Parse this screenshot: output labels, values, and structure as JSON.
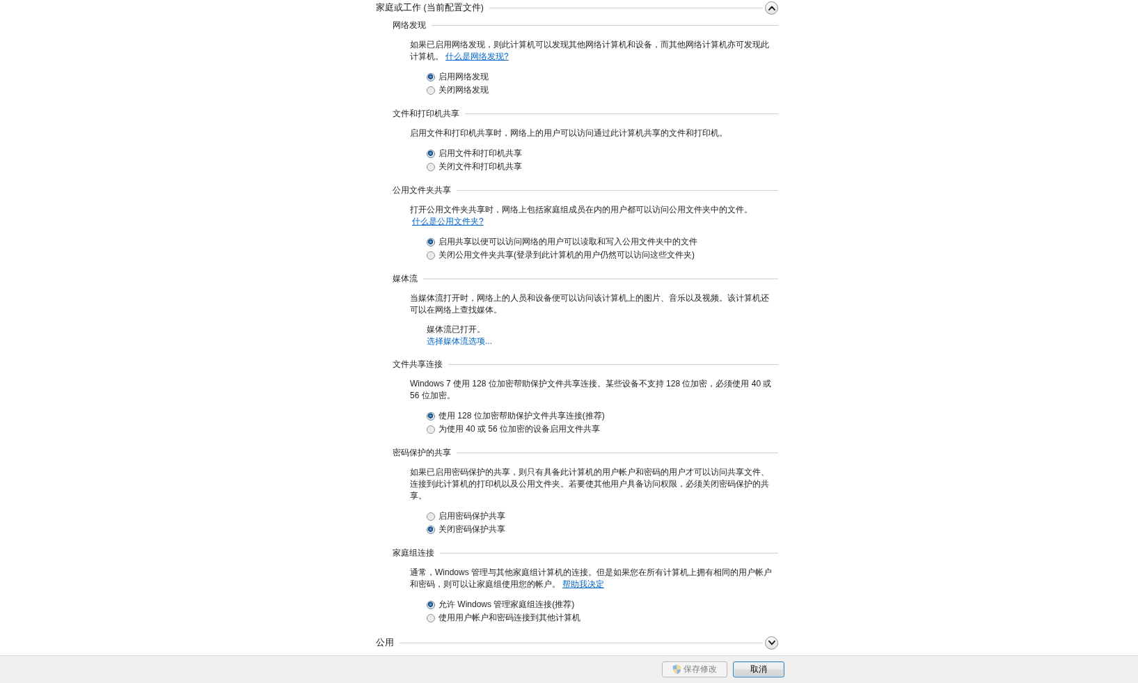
{
  "profiles": [
    {
      "title": "家庭或工作 (当前配置文件)",
      "expanded": true,
      "sections": [
        {
          "kind": "radio",
          "heading": "网络发现",
          "description": "如果已启用网络发现，则此计算机可以发现其他网络计算机和设备，而其他网络计算机亦可发现此计算机。",
          "help_link": "什么是网络发现?",
          "options": [
            {
              "label": "启用网络发现",
              "selected": true
            },
            {
              "label": "关闭网络发现",
              "selected": false
            }
          ]
        },
        {
          "kind": "radio",
          "heading": "文件和打印机共享",
          "description": "启用文件和打印机共享时，网络上的用户可以访问通过此计算机共享的文件和打印机。",
          "options": [
            {
              "label": "启用文件和打印机共享",
              "selected": true
            },
            {
              "label": "关闭文件和打印机共享",
              "selected": false
            }
          ]
        },
        {
          "kind": "radio",
          "heading": "公用文件夹共享",
          "description": "打开公用文件夹共享时，网络上包括家庭组成员在内的用户都可以访问公用文件夹中的文件。",
          "help_link": "什么是公用文件夹?",
          "options": [
            {
              "label": "启用共享以便可以访问网络的用户可以读取和写入公用文件夹中的文件",
              "selected": true
            },
            {
              "label": "关闭公用文件夹共享(登录到此计算机的用户仍然可以访问这些文件夹)",
              "selected": false
            }
          ]
        },
        {
          "kind": "status",
          "heading": "媒体流",
          "description": "当媒体流打开时，网络上的人员和设备便可以访问该计算机上的图片、音乐以及视频。该计算机还可以在网络上查找媒体。",
          "status": "媒体流已打开。",
          "action_link": "选择媒体流选项..."
        },
        {
          "kind": "radio",
          "heading": "文件共享连接",
          "description": "Windows 7 使用 128 位加密帮助保护文件共享连接。某些设备不支持 128 位加密，必须使用 40 或 56 位加密。",
          "options": [
            {
              "label": "使用 128 位加密帮助保护文件共享连接(推荐)",
              "selected": true
            },
            {
              "label": "为使用 40 或 56 位加密的设备启用文件共享",
              "selected": false
            }
          ]
        },
        {
          "kind": "radio",
          "heading": "密码保护的共享",
          "description": "如果已启用密码保护的共享，则只有具备此计算机的用户帐户和密码的用户才可以访问共享文件、连接到此计算机的打印机以及公用文件夹。若要使其他用户具备访问权限，必须关闭密码保护的共享。",
          "options": [
            {
              "label": "启用密码保护共享",
              "selected": false
            },
            {
              "label": "关闭密码保护共享",
              "selected": true
            }
          ]
        },
        {
          "kind": "radio",
          "heading": "家庭组连接",
          "description": "通常，Windows 管理与其他家庭组计算机的连接。但是如果您在所有计算机上拥有相同的用户帐户和密码，则可以让家庭组使用您的帐户。",
          "help_link": "帮助我决定",
          "options": [
            {
              "label": "允许 Windows 管理家庭组连接(推荐)",
              "selected": true
            },
            {
              "label": "使用用户帐户和密码连接到其他计算机",
              "selected": false
            }
          ]
        }
      ]
    },
    {
      "title": "公用",
      "expanded": false
    }
  ],
  "buttons": [
    {
      "label": "保存修改",
      "disabled": true,
      "requires_admin": true,
      "focused": false
    },
    {
      "label": "取消",
      "disabled": false,
      "requires_admin": false,
      "focused": true
    }
  ]
}
